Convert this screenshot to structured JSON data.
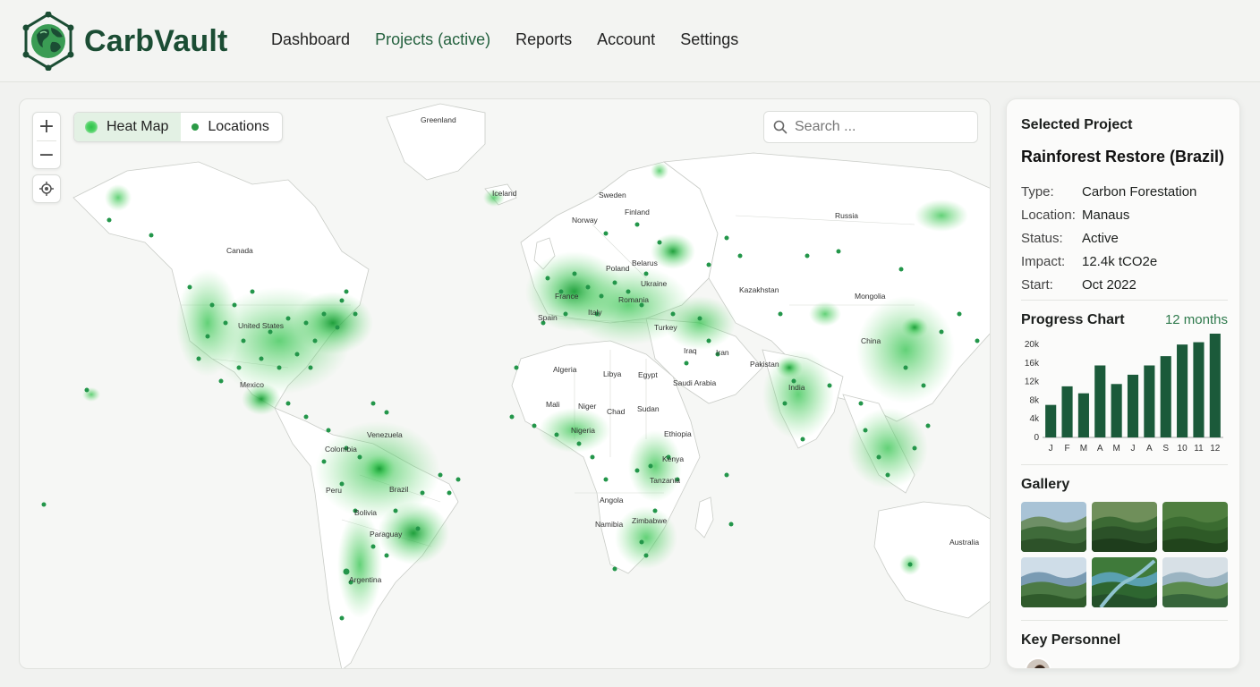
{
  "app": {
    "brand": "CarbVault",
    "nav": [
      "Dashboard",
      "Projects (active)",
      "Reports",
      "Account",
      "Settings"
    ],
    "active_nav": 1
  },
  "colors": {
    "brand": "#1b4d34",
    "accent": "#2f7a4d",
    "heat": "#39c24f",
    "bar": "#1b5a3a"
  },
  "map": {
    "layers": {
      "heatmap": "Heat Map",
      "locations": "Locations"
    },
    "search": {
      "placeholder": "Search ..."
    },
    "icons": {
      "zoom_in": "plus-icon",
      "zoom_out": "minus-icon",
      "locate": "locate-icon",
      "search": "search-icon"
    },
    "labels": [
      "Greenland",
      "Iceland",
      "Sweden",
      "Finland",
      "Norway",
      "Russia",
      "Canada",
      "Poland",
      "Belarus",
      "Ukraine",
      "Kazakhstan",
      "Mongolia",
      "France",
      "Romania",
      "Italy",
      "Spain",
      "Turkey",
      "United States",
      "Iraq",
      "Iran",
      "China",
      "Pakistan",
      "Algeria",
      "Libya",
      "Egypt",
      "Saudi Arabia",
      "India",
      "Mexico",
      "Mali",
      "Niger",
      "Chad",
      "Sudan",
      "Ethiopia",
      "Nigeria",
      "Venezuela",
      "Colombia",
      "Kenya",
      "Tanzania",
      "Peru",
      "Brazil",
      "Bolivia",
      "Angola",
      "Zimbabwe",
      "Namibia",
      "Paraguay",
      "Argentina",
      "Australia"
    ]
  },
  "panel": {
    "title": "Selected Project",
    "project_name": "Rainforest Restore (Brazil)",
    "details": [
      {
        "key": "Type:",
        "value": "Carbon Forestation"
      },
      {
        "key": "Location:",
        "value": "Manaus"
      },
      {
        "key": "Status:",
        "value": "Active"
      },
      {
        "key": "Impact:",
        "value": "12.4k tCO2e"
      },
      {
        "key": "Start:",
        "value": "Oct 2022"
      }
    ],
    "chart_title": "Progress Chart",
    "chart_range": "12 months",
    "gallery_title": "Gallery",
    "gallery_images": [
      "forest-hills-photo",
      "rainforest-canopy-photo",
      "aerial-forest-photo",
      "river-valley-photo",
      "forest-river-photo",
      "misty-hills-photo"
    ],
    "personnel_title": "Key Personnel"
  },
  "chart_data": {
    "type": "bar",
    "title": "Progress Chart",
    "categories": [
      "J",
      "F",
      "M",
      "A",
      "M",
      "J",
      "A",
      "S",
      "10",
      "11",
      "12"
    ],
    "values": [
      7000,
      11000,
      9500,
      15500,
      11500,
      13500,
      15500,
      17500,
      20000,
      20500,
      22500
    ],
    "yticks": [
      "0",
      "4k",
      "8k",
      "12k",
      "16k",
      "20k"
    ],
    "ylim": [
      0,
      24000
    ],
    "xlabel": "",
    "ylabel": ""
  }
}
